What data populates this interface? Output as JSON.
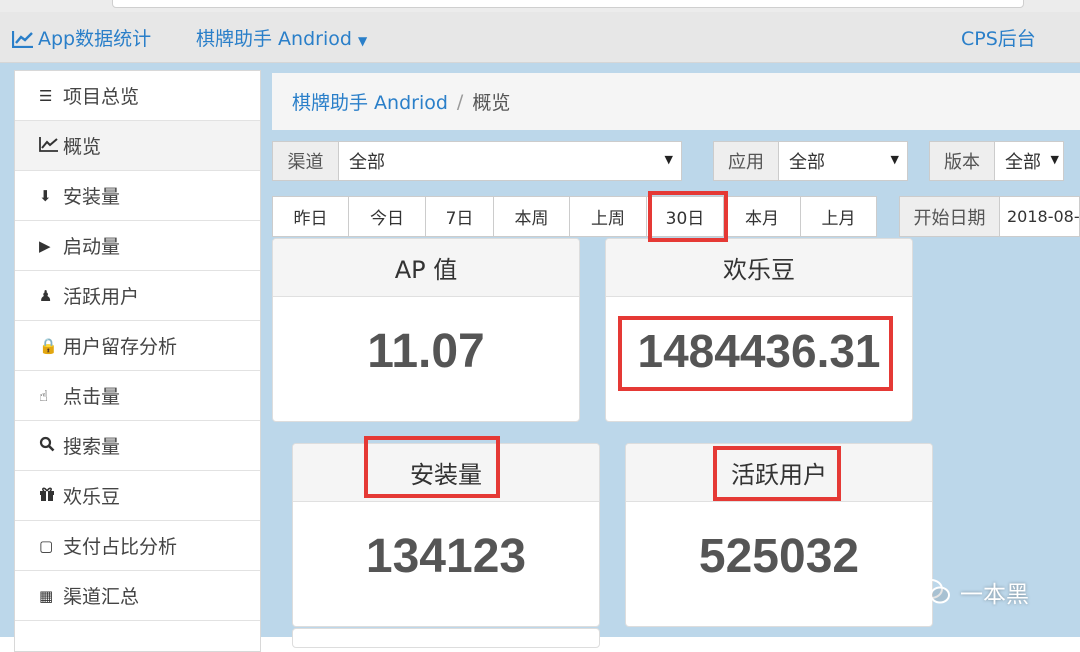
{
  "navbar": {
    "brand_label": "App数据统计",
    "app_dropdown_label": "棋牌助手 Andriod",
    "cps_label": "CPS后台"
  },
  "sidebar": {
    "items": [
      {
        "label": "项目总览",
        "icon": "list-icon"
      },
      {
        "label": "概览",
        "icon": "line-chart-icon"
      },
      {
        "label": "安装量",
        "icon": "download-icon"
      },
      {
        "label": "启动量",
        "icon": "play-icon"
      },
      {
        "label": "活跃用户",
        "icon": "person-icon"
      },
      {
        "label": "用户留存分析",
        "icon": "lock-icon"
      },
      {
        "label": "点击量",
        "icon": "hand-pointer-icon"
      },
      {
        "label": "搜索量",
        "icon": "search-icon"
      },
      {
        "label": "欢乐豆",
        "icon": "gift-icon"
      },
      {
        "label": "支付占比分析",
        "icon": "square-icon"
      },
      {
        "label": "渠道汇总",
        "icon": "table-icon"
      }
    ]
  },
  "breadcrumb": {
    "link": "棋牌助手 Andriod",
    "separator": "/",
    "current": "概览"
  },
  "filters": {
    "channel_label": "渠道",
    "channel_value": "全部",
    "app_label": "应用",
    "app_value": "全部",
    "version_label": "版本",
    "version_value": "全部",
    "start_date_label": "开始日期",
    "start_date_value": "2018-08-"
  },
  "date_buttons": [
    "昨日",
    "今日",
    "7日",
    "本周",
    "上周",
    "30日",
    "本月",
    "上月"
  ],
  "cards": [
    {
      "title": "AP 值",
      "value": "11.07"
    },
    {
      "title": "欢乐豆",
      "value": "1484436.31"
    },
    {
      "title": "安装量",
      "value": "134123"
    },
    {
      "title": "活跃用户",
      "value": "525032"
    }
  ],
  "watermark": {
    "text": "一本黑"
  },
  "colors": {
    "link": "#2a7fc9",
    "highlight": "#e53935",
    "background": "#bcd7ea"
  }
}
